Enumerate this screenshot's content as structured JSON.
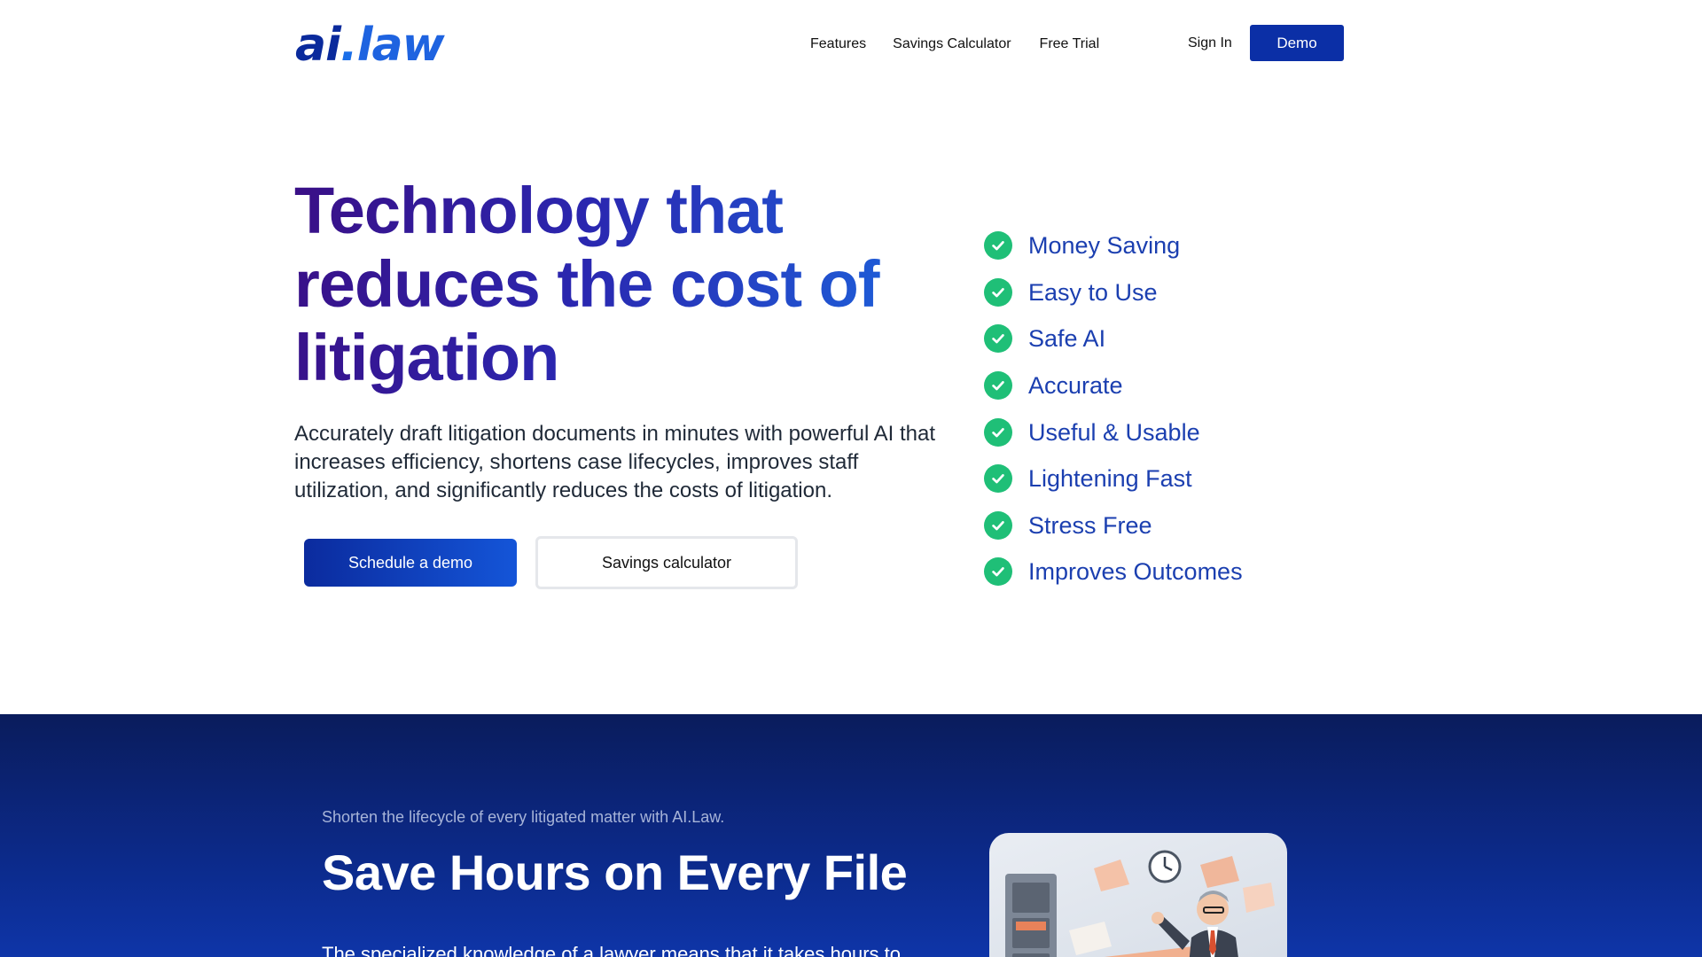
{
  "header": {
    "logo": {
      "ai": "ai",
      "dot": ".",
      "law": "law"
    },
    "nav": [
      {
        "label": "Features"
      },
      {
        "label": "Savings Calculator"
      },
      {
        "label": "Free Trial"
      }
    ],
    "sign_in": "Sign In",
    "demo": "Demo"
  },
  "hero": {
    "title": "Technology that reduces the cost of litigation",
    "subtitle": "Accurately draft litigation documents in minutes with powerful AI that increases efficiency, shortens case lifecycles, improves staff utilization, and significantly reduces the costs of litigation.",
    "primary_button": "Schedule a demo",
    "secondary_button": "Savings calculator",
    "features": [
      {
        "label": "Money Saving",
        "icon": "check-circle-icon"
      },
      {
        "label": "Easy to Use",
        "icon": "check-circle-icon"
      },
      {
        "label": "Safe AI",
        "icon": "check-circle-icon"
      },
      {
        "label": "Accurate",
        "icon": "check-circle-icon"
      },
      {
        "label": "Useful & Usable",
        "icon": "check-circle-icon"
      },
      {
        "label": "Lightening Fast",
        "icon": "check-circle-icon"
      },
      {
        "label": "Stress Free",
        "icon": "check-circle-icon"
      },
      {
        "label": "Improves Outcomes",
        "icon": "check-circle-icon"
      }
    ]
  },
  "lower": {
    "kicker": "Shorten the lifecycle of every litigated matter with AI.Law.",
    "title": "Save Hours on Every File",
    "body": "The specialized knowledge of a lawyer means that it takes hours to"
  },
  "colors": {
    "brand_blue": "#0b2fa6",
    "check_green": "#1fbf77",
    "feature_text": "#1b3fb0",
    "lower_bg": "#0c2a8a"
  }
}
